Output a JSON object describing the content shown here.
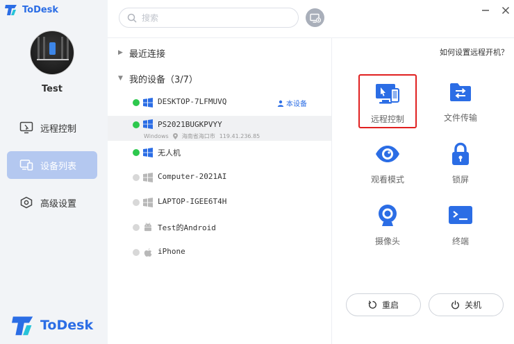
{
  "app": {
    "name": "ToDesk"
  },
  "user": {
    "name": "Test"
  },
  "sidebar": {
    "items": [
      {
        "label": "远程控制",
        "icon": "remote-control-icon"
      },
      {
        "label": "设备列表",
        "icon": "device-list-icon",
        "active": true
      },
      {
        "label": "高级设置",
        "icon": "settings-icon"
      }
    ]
  },
  "search": {
    "placeholder": "搜索",
    "value": ""
  },
  "groups": {
    "recent": {
      "label": "最近连接",
      "expanded": false
    },
    "my_devices": {
      "label": "我的设备（3/7）",
      "expanded": true
    }
  },
  "devices": [
    {
      "name": "DESKTOP-7LFMUVQ",
      "os": "windows",
      "online": true,
      "this_device_label": "本设备"
    },
    {
      "name": "PS2021BUGKPVYY",
      "os": "windows",
      "online": true,
      "selected": true,
      "os_label": "Windows",
      "location": "海南省海口市",
      "ip": "119.41.236.85"
    },
    {
      "name": "无人机",
      "os": "windows",
      "online": true
    },
    {
      "name": "Computer-2021AI",
      "os": "windows",
      "online": false
    },
    {
      "name": "LAPTOP-IGEE6T4H",
      "os": "windows",
      "online": false
    },
    {
      "name": "Test的Android",
      "os": "android",
      "online": false
    },
    {
      "name": "iPhone",
      "os": "apple",
      "online": false
    }
  ],
  "panel": {
    "help_link": "如何设置远程开机？",
    "actions": [
      {
        "label": "远程控制",
        "icon": "remote-control-icon",
        "highlighted": true
      },
      {
        "label": "文件传输",
        "icon": "file-transfer-icon"
      },
      {
        "label": "观看模式",
        "icon": "eye-icon"
      },
      {
        "label": "锁屏",
        "icon": "lock-icon"
      },
      {
        "label": "摄像头",
        "icon": "camera-icon"
      },
      {
        "label": "终端",
        "icon": "terminal-icon"
      }
    ],
    "restart_label": "重启",
    "shutdown_label": "关机"
  },
  "colors": {
    "brand": "#2b6de5",
    "online": "#2dc84d",
    "offline": "#d8d8d8",
    "sidebar_active": "#b4c8f0",
    "highlight_border": "#e02020"
  }
}
